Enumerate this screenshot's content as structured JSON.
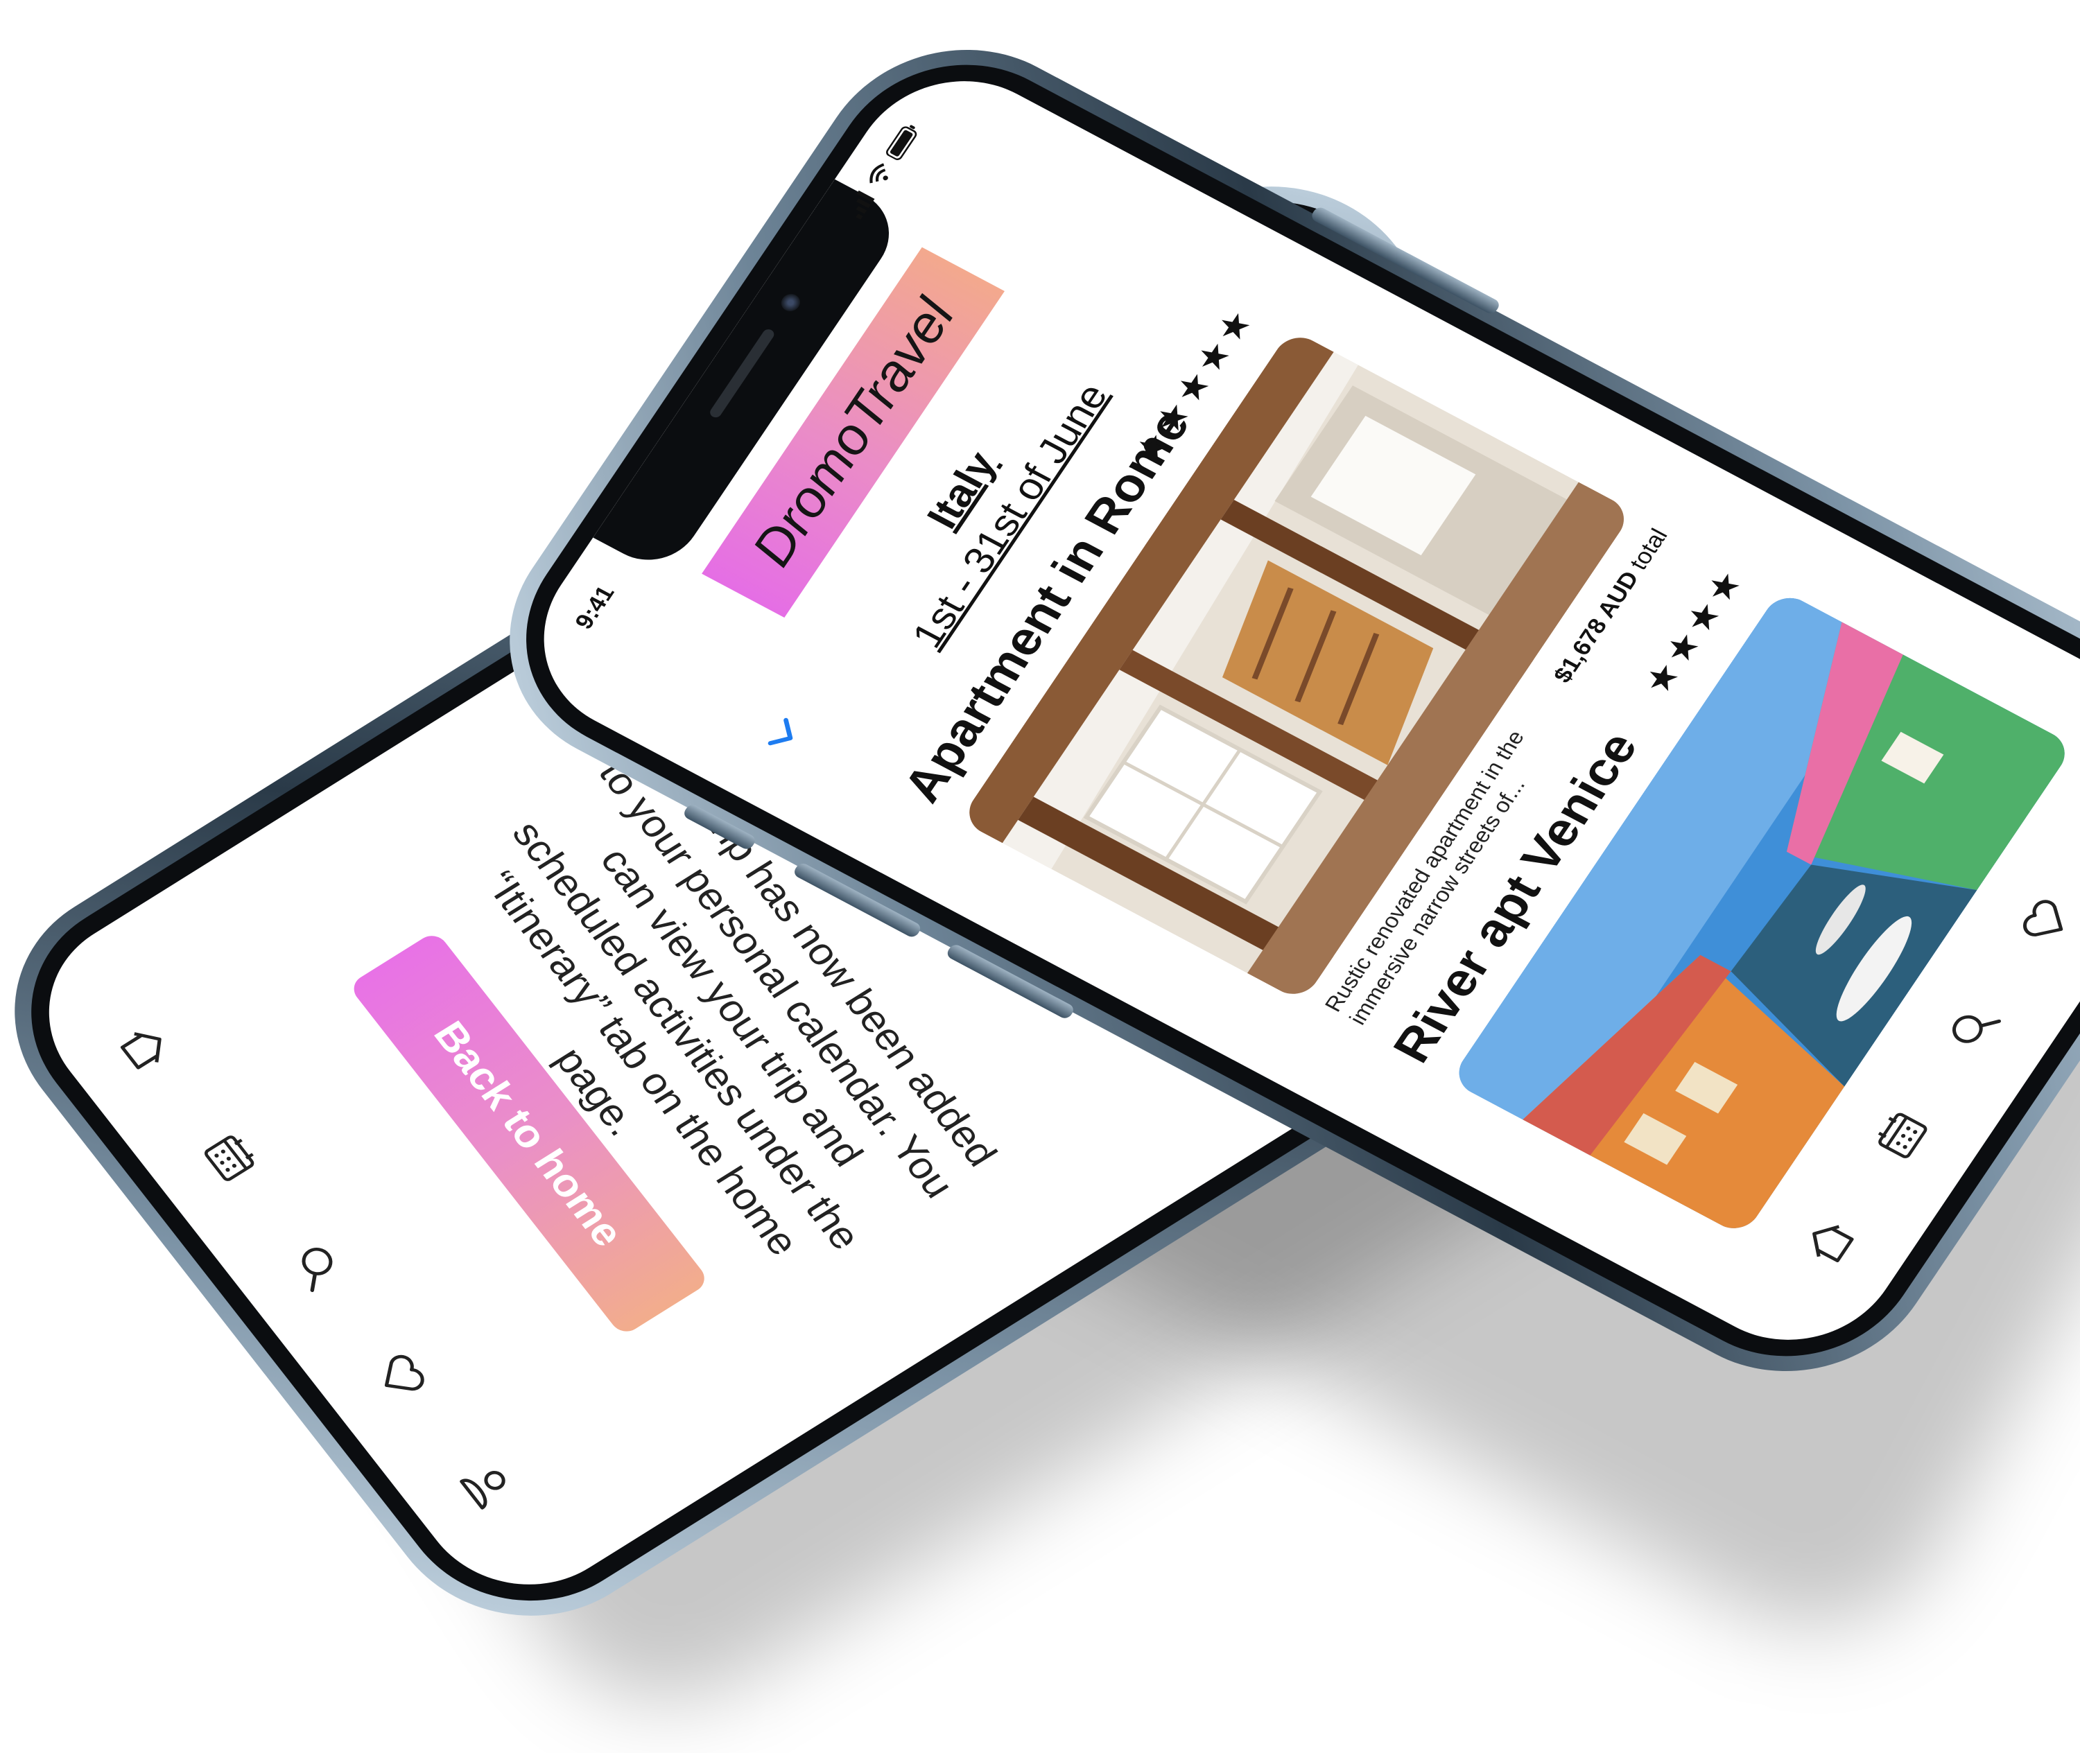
{
  "status": {
    "time": "9:41"
  },
  "brand": {
    "name": "DromoTravel"
  },
  "back_phone": {
    "confirmation_text": "Your trip has now been added to your personal calendar. You can view your trip and scheduled activities under the “Itinerary” tab on the home page.",
    "back_home_label": "Back to home"
  },
  "front_phone": {
    "trip": {
      "destination": "Italy",
      "dates": "1st - 31st of June"
    },
    "listings": [
      {
        "title": "Apartment in Rome",
        "rating_stars": "★★★★★",
        "rating": 5,
        "description": "Rustic renovated apartment in the immersive narrow streets of...",
        "price": "$1,678 AUD",
        "price_suffix": "total"
      },
      {
        "title": "River apt Venice",
        "rating_stars": "★★★★",
        "rating": 4
      }
    ]
  },
  "tab_bar": {
    "icons": [
      "home-icon",
      "calendar-icon",
      "search-icon",
      "heart-icon",
      "profile-icon"
    ]
  },
  "colors": {
    "brand_gradient_start": "#e56ee5",
    "brand_gradient_end": "#f3a98d",
    "frame": "#2a3a48",
    "link_blue": "#1e7cf0"
  }
}
